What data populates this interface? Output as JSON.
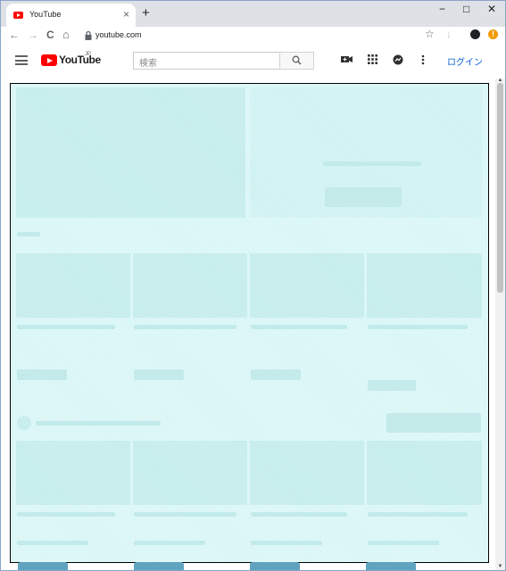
{
  "browser": {
    "tab_title": "YouTube",
    "tab_close": "×",
    "new_tab": "+",
    "minimize": "−",
    "maximize": "□",
    "close": "✕",
    "back": "←",
    "forward": "→",
    "reload": "C",
    "home": "⌂",
    "url": "youtube.com",
    "star": "☆",
    "download": "↓",
    "update_badge": "!"
  },
  "youtube": {
    "logo_text": "YouTube",
    "logo_region": "JP",
    "search_placeholder": "検索",
    "login_label": "ログイン"
  },
  "scrollbar": {
    "up": "▲",
    "down": "▼"
  },
  "colors": {
    "overlay": "#d9f6f6",
    "brand": "#ff0000",
    "link": "#065fd4"
  }
}
